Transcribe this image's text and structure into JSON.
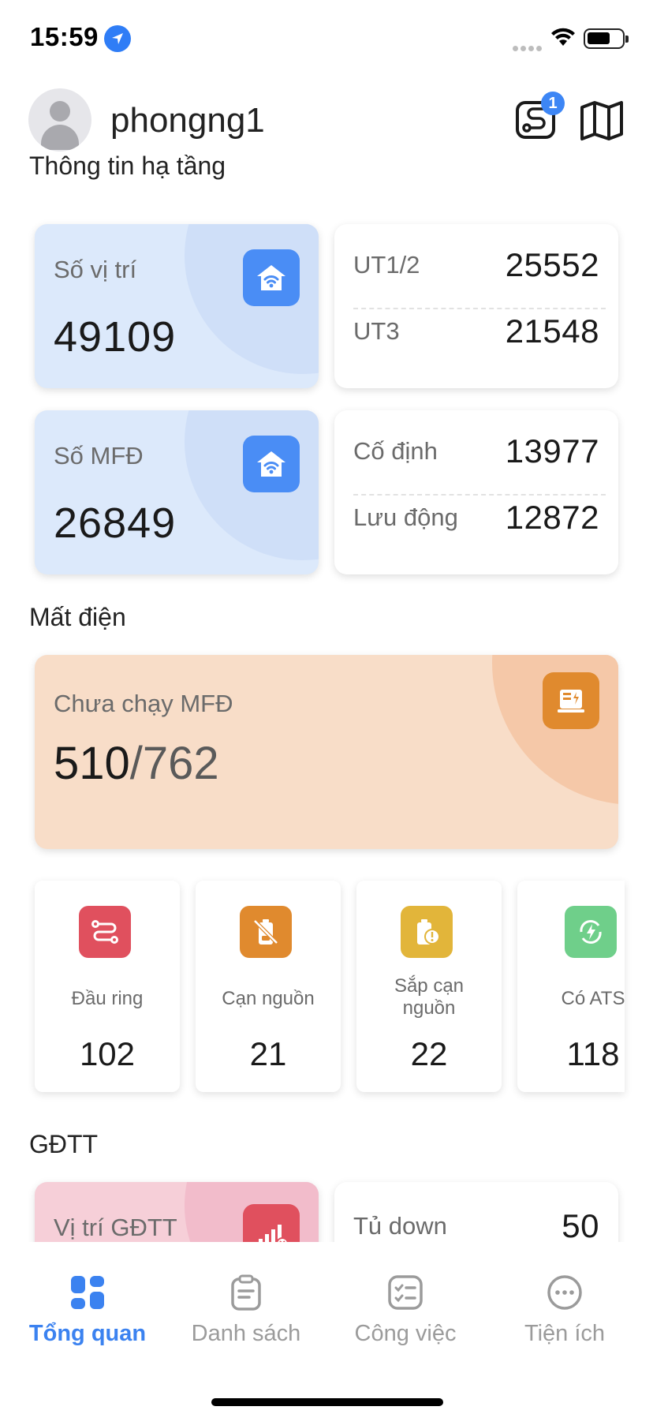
{
  "status_bar": {
    "time": "15:59"
  },
  "header": {
    "username": "phongng1",
    "notification_count": "1"
  },
  "infrastructure": {
    "title": "Thông tin hạ tầng",
    "locations": {
      "label": "Số vị trí",
      "value": "49109"
    },
    "location_split": [
      {
        "label": "UT1/2",
        "value": "25552"
      },
      {
        "label": "UT3",
        "value": "21548"
      }
    ],
    "generators": {
      "label": "Số MFĐ",
      "value": "26849"
    },
    "generator_split": [
      {
        "label": "Cố định",
        "value": "13977"
      },
      {
        "label": "Lưu động",
        "value": "12872"
      }
    ]
  },
  "outage": {
    "title": "Mất điện",
    "not_running": {
      "label": "Chưa chạy MFĐ",
      "current": "510",
      "total": "/762"
    },
    "stats": [
      {
        "label": "Đầu ring",
        "value": "102",
        "color": "#e0505e",
        "icon": "route-icon"
      },
      {
        "label": "Cạn nguồn",
        "value": "21",
        "color": "#e08a2e",
        "icon": "battery-empty-icon"
      },
      {
        "label": "Sắp cạn nguồn",
        "value": "22",
        "color": "#e2b53a",
        "icon": "battery-warning-icon"
      },
      {
        "label": "Có ATS",
        "value": "118",
        "color": "#6fcf8a",
        "icon": "ats-icon"
      }
    ]
  },
  "gdtt": {
    "title": "GĐTT",
    "positions": {
      "label": "Vị trí GĐTT"
    },
    "cabinet_down": {
      "label": "Tủ down",
      "value": "50"
    }
  },
  "nav": {
    "items": [
      {
        "label": "Tổng quan",
        "icon": "dashboard-icon",
        "active": true
      },
      {
        "label": "Danh sách",
        "icon": "clipboard-icon",
        "active": false
      },
      {
        "label": "Công việc",
        "icon": "checklist-icon",
        "active": false
      },
      {
        "label": "Tiện ích",
        "icon": "more-icon",
        "active": false
      }
    ]
  },
  "colors": {
    "accent": "#3b82f0",
    "blue_card": "#dce9fb",
    "outage_card": "#f8ddc8",
    "icon_blue": "#4a8df5",
    "icon_orange": "#e08a2e"
  }
}
